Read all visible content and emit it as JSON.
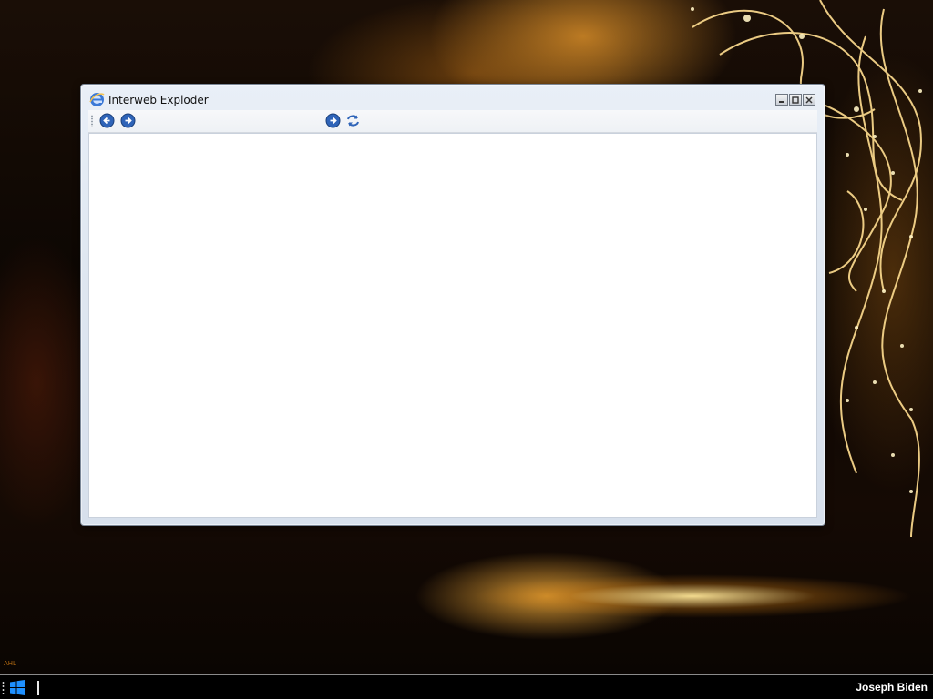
{
  "desktop": {
    "wallpaper_colors": {
      "base": "#0d0703",
      "accent": "#e8a93a",
      "highlight": "#fff3c4"
    },
    "watermark_text": "AHL"
  },
  "window": {
    "title": "Interweb Exploder",
    "icon": "browser-e-icon",
    "controls": [
      "minimize-icon",
      "maximize-icon",
      "close-icon"
    ],
    "toolbar": {
      "back_icon": "back-arrow-icon",
      "forward_icon": "forward-arrow-icon",
      "go_icon": "go-arrow-icon",
      "refresh_icon": "refresh-icon",
      "accent_color": "#2f64b8"
    }
  },
  "taskbar": {
    "start_icon": "windows-logo-icon",
    "user_name": "Joseph Biden"
  }
}
